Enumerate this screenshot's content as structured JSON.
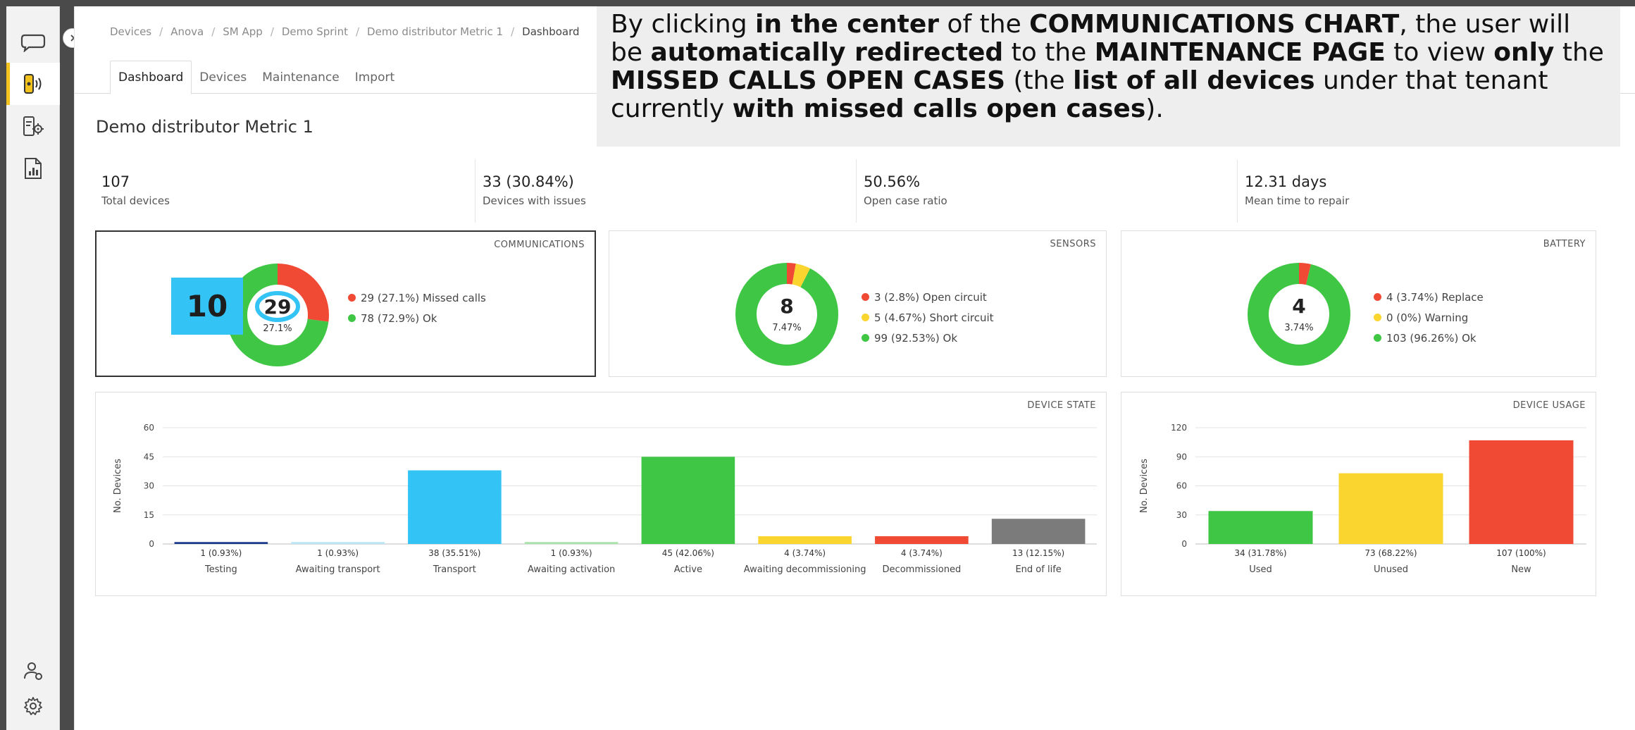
{
  "sidebar": {
    "items": [
      {
        "name": "chat-icon"
      },
      {
        "name": "device-signal-icon"
      },
      {
        "name": "device-settings-icon"
      },
      {
        "name": "report-chart-icon"
      }
    ],
    "bottom": [
      {
        "name": "user-settings-icon"
      },
      {
        "name": "gear-icon"
      }
    ]
  },
  "breadcrumb": [
    "Devices",
    "Anova",
    "SM App",
    "Demo Sprint",
    "Demo distributor Metric 1",
    "Dashboard"
  ],
  "tabs": [
    {
      "label": "Dashboard",
      "active": true
    },
    {
      "label": "Devices",
      "active": false
    },
    {
      "label": "Maintenance",
      "active": false
    },
    {
      "label": "Import",
      "active": false
    }
  ],
  "page_title": "Demo distributor Metric 1",
  "kpis": [
    {
      "value": "107",
      "label": "Total devices"
    },
    {
      "value": "33 (30.84%)",
      "label": "Devices with issues"
    },
    {
      "value": "50.56%",
      "label": "Open case ratio"
    },
    {
      "value": "12.31 days",
      "label": "Mean time to repair"
    }
  ],
  "colors": {
    "red": "#f04a35",
    "green": "#3fc644",
    "yellow": "#fbd52f",
    "cyan": "#33c4f5",
    "navy": "#1a3a8c",
    "lightblue": "#b9e6f7",
    "lightgreen": "#a8e3aa",
    "gray": "#7b7b7b",
    "accent": "#f3c21d"
  },
  "callout": {
    "value": "10"
  },
  "annotation": {
    "segments": [
      {
        "t": "By clicking ",
        "b": false
      },
      {
        "t": "in the center",
        "b": true
      },
      {
        "t": " of the ",
        "b": false
      },
      {
        "t": "COMMUNICATIONS CHART",
        "b": true
      },
      {
        "t": ", the user will be ",
        "b": false
      },
      {
        "t": "automatically redirected",
        "b": true
      },
      {
        "t": " to the ",
        "b": false
      },
      {
        "t": "MAINTENANCE PAGE",
        "b": true
      },
      {
        "t": " to view ",
        "b": false
      },
      {
        "t": "only",
        "b": true
      },
      {
        "t": " the ",
        "b": false
      },
      {
        "t": "MISSED CALLS OPEN CASES",
        "b": true
      },
      {
        "t": " (the ",
        "b": false
      },
      {
        "t": "list of all devices",
        "b": true
      },
      {
        "t": " under that tenant currently ",
        "b": false
      },
      {
        "t": "with missed calls open cases",
        "b": true
      },
      {
        "t": ").",
        "b": false
      }
    ]
  },
  "chart_data": [
    {
      "type": "pie",
      "title": "COMMUNICATIONS",
      "center_value": "29",
      "center_percent": "27.1%",
      "slices": [
        {
          "label": "Missed calls",
          "value": 29,
          "percent": "27.1%",
          "legend": "29 (27.1%)",
          "color": "#f04a35"
        },
        {
          "label": "Ok",
          "value": 78,
          "percent": "72.9%",
          "legend": "78 (72.9%)",
          "color": "#3fc644"
        }
      ]
    },
    {
      "type": "pie",
      "title": "SENSORS",
      "center_value": "8",
      "center_percent": "7.47%",
      "slices": [
        {
          "label": "Open circuit",
          "value": 3,
          "legend": "3 (2.8%)",
          "color": "#f04a35"
        },
        {
          "label": "Short circuit",
          "value": 5,
          "legend": "5 (4.67%)",
          "color": "#fbd52f"
        },
        {
          "label": "Ok",
          "value": 99,
          "legend": "99 (92.53%)",
          "color": "#3fc644"
        }
      ]
    },
    {
      "type": "pie",
      "title": "BATTERY",
      "center_value": "4",
      "center_percent": "3.74%",
      "slices": [
        {
          "label": "Replace",
          "value": 4,
          "legend": "4 (3.74%)",
          "color": "#f04a35"
        },
        {
          "label": "Warning",
          "value": 0,
          "legend": "0 (0%)",
          "color": "#fbd52f"
        },
        {
          "label": "Ok",
          "value": 103,
          "legend": "103 (96.26%)",
          "color": "#3fc644"
        }
      ]
    },
    {
      "type": "bar",
      "title": "DEVICE STATE",
      "ylabel": "No. Devices",
      "ylim": [
        0,
        60
      ],
      "yticks": [
        0,
        15,
        30,
        45,
        60
      ],
      "grid": true,
      "categories": [
        "Testing",
        "Awaiting transport",
        "Transport",
        "Awaiting activation",
        "Active",
        "Awaiting decommissioning",
        "Decommissioned",
        "End of life"
      ],
      "values": [
        1,
        1,
        38,
        1,
        45,
        4,
        4,
        13
      ],
      "value_labels": [
        "1 (0.93%)",
        "1 (0.93%)",
        "38 (35.51%)",
        "1 (0.93%)",
        "45 (42.06%)",
        "4 (3.74%)",
        "4 (3.74%)",
        "13 (12.15%)"
      ],
      "colors": [
        "#1a3a8c",
        "#b9e6f7",
        "#33c4f5",
        "#a8e3aa",
        "#3fc644",
        "#fbd52f",
        "#f04a35",
        "#7b7b7b"
      ]
    },
    {
      "type": "bar",
      "title": "DEVICE USAGE",
      "ylabel": "No. Devices",
      "ylim": [
        0,
        120
      ],
      "yticks": [
        0,
        30,
        60,
        90,
        120
      ],
      "grid": true,
      "categories": [
        "Used",
        "Unused",
        "New"
      ],
      "values": [
        34,
        73,
        107
      ],
      "value_labels": [
        "34 (31.78%)",
        "73 (68.22%)",
        "107 (100%)"
      ],
      "colors": [
        "#3fc644",
        "#fbd52f",
        "#f04a35"
      ]
    }
  ]
}
